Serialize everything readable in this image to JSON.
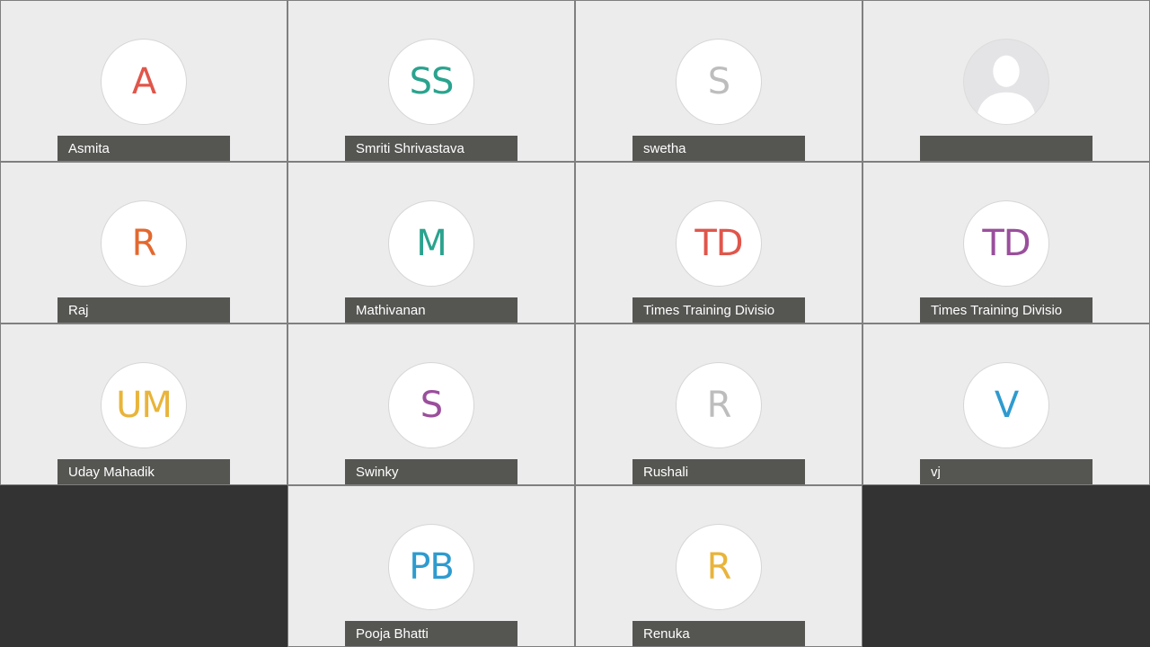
{
  "participants": [
    {
      "name": "Asmita",
      "initials": "A",
      "color": "#e0564b"
    },
    {
      "name": "Smriti Shrivastava",
      "initials": "SS",
      "color": "#2aa38e"
    },
    {
      "name": "swetha",
      "initials": "S",
      "color": "#bdbdbd"
    },
    {
      "name": "",
      "initials": "",
      "color": "#ffffff",
      "avatar_icon": "person-silhouette-icon"
    },
    {
      "name": "Raj",
      "initials": "R",
      "color": "#e3682e"
    },
    {
      "name": "Mathivanan",
      "initials": "M",
      "color": "#2aa38e"
    },
    {
      "name": "Times Training Divisio",
      "initials": "TD",
      "color": "#e0564b"
    },
    {
      "name": "Times Training Divisio",
      "initials": "TD",
      "color": "#9a4f9c"
    },
    {
      "name": "Uday Mahadik",
      "initials": "UM",
      "color": "#e8b43a"
    },
    {
      "name": "Swinky",
      "initials": "S",
      "color": "#9a4f9c"
    },
    {
      "name": "Rushali",
      "initials": "R",
      "color": "#bdbdbd"
    },
    {
      "name": "vj",
      "initials": "V",
      "color": "#2e9bcf"
    },
    {
      "name": "Pooja Bhatti",
      "initials": "PB",
      "color": "#2e9bcf"
    },
    {
      "name": "Renuka",
      "initials": "R",
      "color": "#e8b43a"
    }
  ]
}
